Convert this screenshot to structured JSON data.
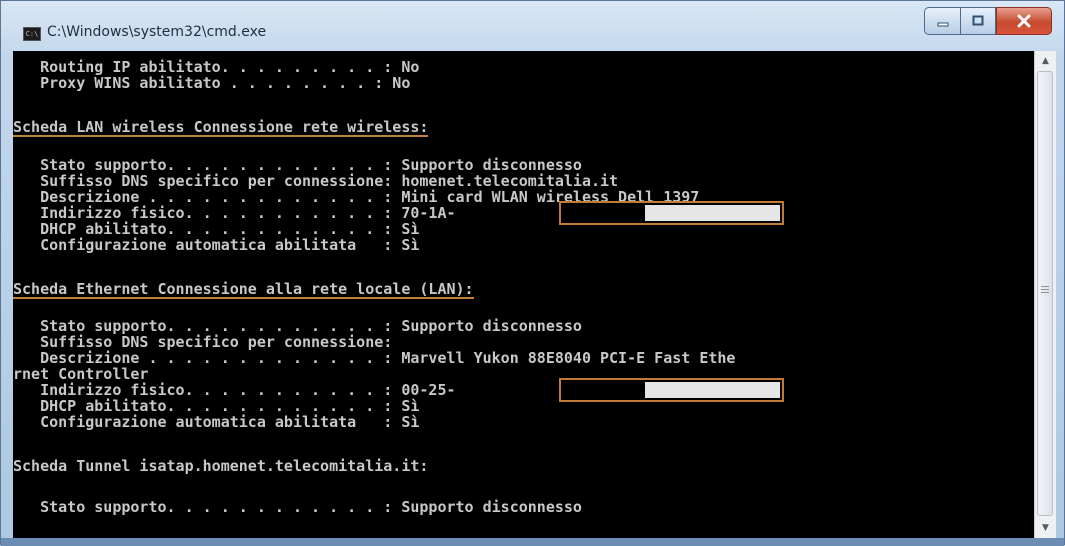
{
  "window": {
    "title": "C:\\Windows\\system32\\cmd.exe",
    "icon": "cmd-icon",
    "icon_text": "C:\\"
  },
  "console": {
    "lines": [
      "   Routing IP abilitato. . . . . . . . . : No",
      "   Proxy WINS abilitato . . . . . . . . : No",
      "Scheda LAN wireless Connessione rete wireless:",
      "   Stato supporto. . . . . . . . . . . . : Supporto disconnesso",
      "   Suffisso DNS specifico per connessione: homenet.telecomitalia.it",
      "   Descrizione . . . . . . . . . . . . . : Mini card WLAN wireless Dell 1397",
      "   Indirizzo fisico. . . . . . . . . . . : 70-1A-",
      "   DHCP abilitato. . . . . . . . . . . . : Sì",
      "   Configurazione automatica abilitata   : Sì",
      "Scheda Ethernet Connessione alla rete locale (LAN):",
      "   Stato supporto. . . . . . . . . . . . : Supporto disconnesso",
      "   Suffisso DNS specifico per connessione:",
      "   Descrizione . . . . . . . . . . . . . : Marvell Yukon 88E8040 PCI-E Fast Ethe",
      "rnet Controller",
      "   Indirizzo fisico. . . . . . . . . . . : 00-25-",
      "   DHCP abilitato. . . . . . . . . . . . : Sì",
      "   Configurazione automatica abilitata   : Sì",
      "Scheda Tunnel isatap.homenet.telecomitalia.it:",
      "   Stato supporto. . . . . . . . . . . . : Supporto disconnesso"
    ]
  },
  "colors": {
    "console_bg": "#000000",
    "console_text": "#c8c8c8",
    "highlight": "#c27a3a",
    "redaction": "#e6e6e6"
  }
}
